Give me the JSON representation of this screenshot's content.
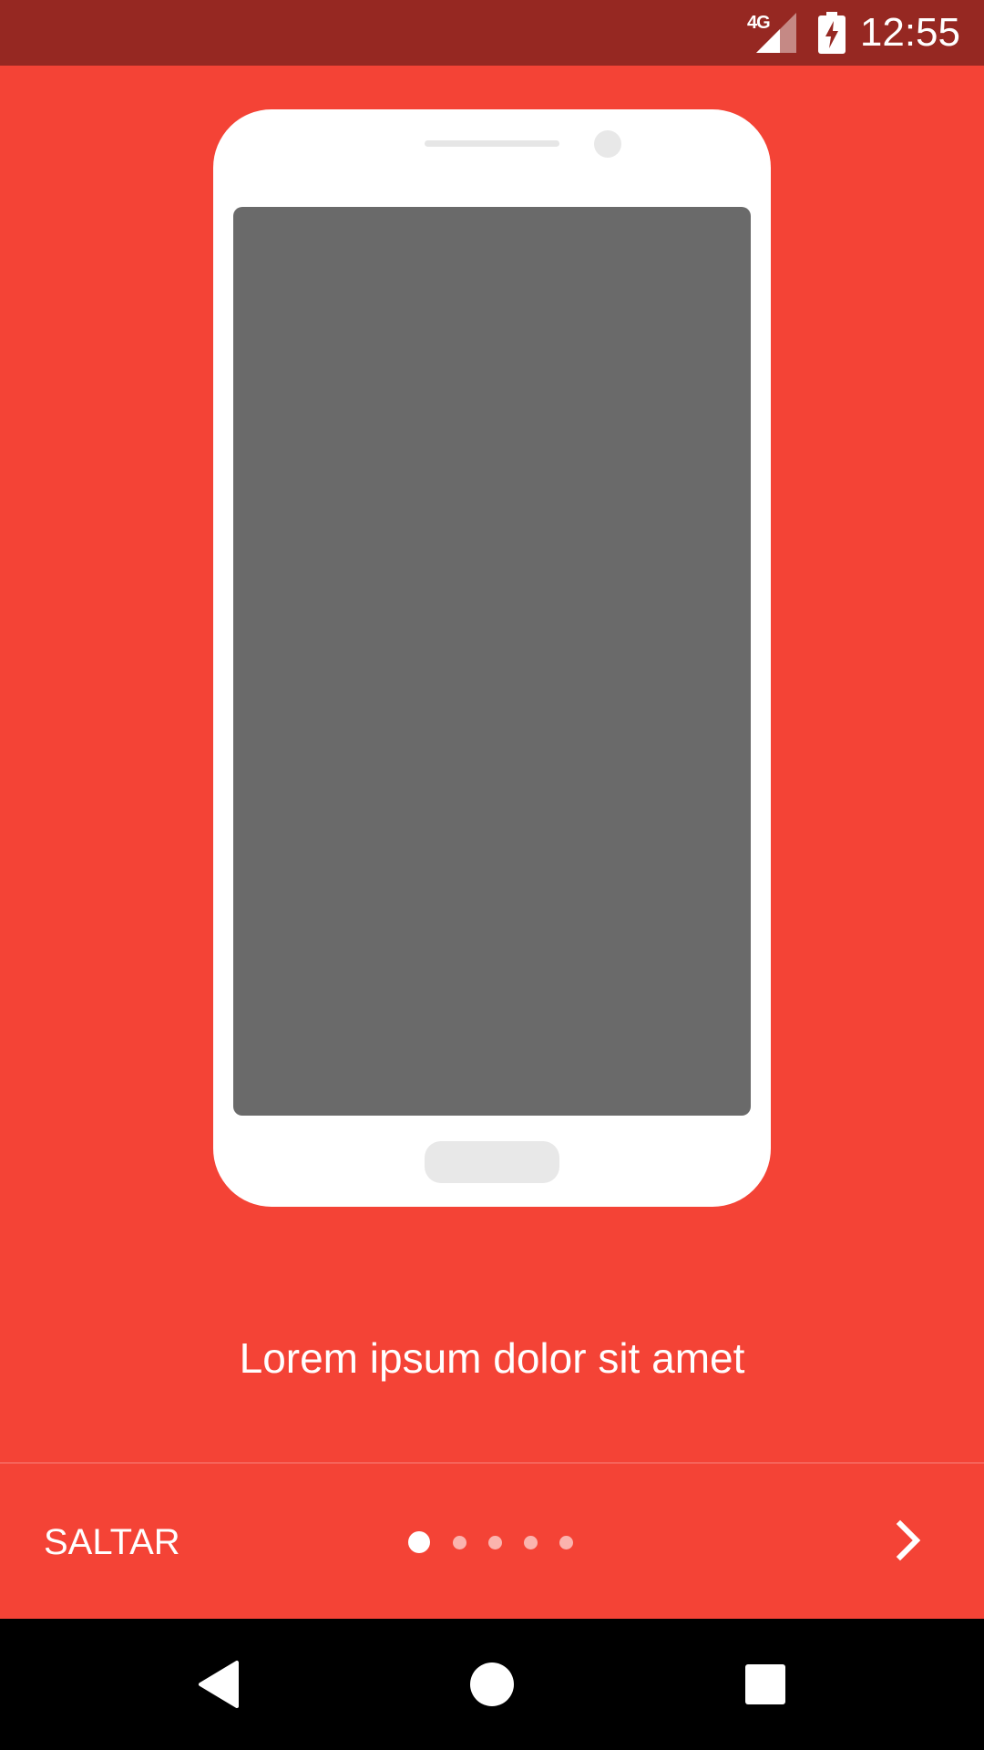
{
  "status_bar": {
    "network_type": "4G",
    "time": "12:55",
    "icons": [
      "signal-icon",
      "battery-charging-icon"
    ]
  },
  "onboarding": {
    "description": "Lorem ipsum dolor sit amet",
    "page_count": 5,
    "current_page": 1
  },
  "controls": {
    "skip_label": "SALTAR",
    "next_icon": "chevron-right-icon"
  },
  "nav_bar": {
    "icons": [
      "back-icon",
      "home-icon",
      "recents-icon"
    ]
  },
  "colors": {
    "background": "#F44336",
    "status_bar": "#962822",
    "phone_body": "#FFFFFF",
    "phone_screen": "#6A6A6A",
    "nav_bar": "#000000"
  }
}
